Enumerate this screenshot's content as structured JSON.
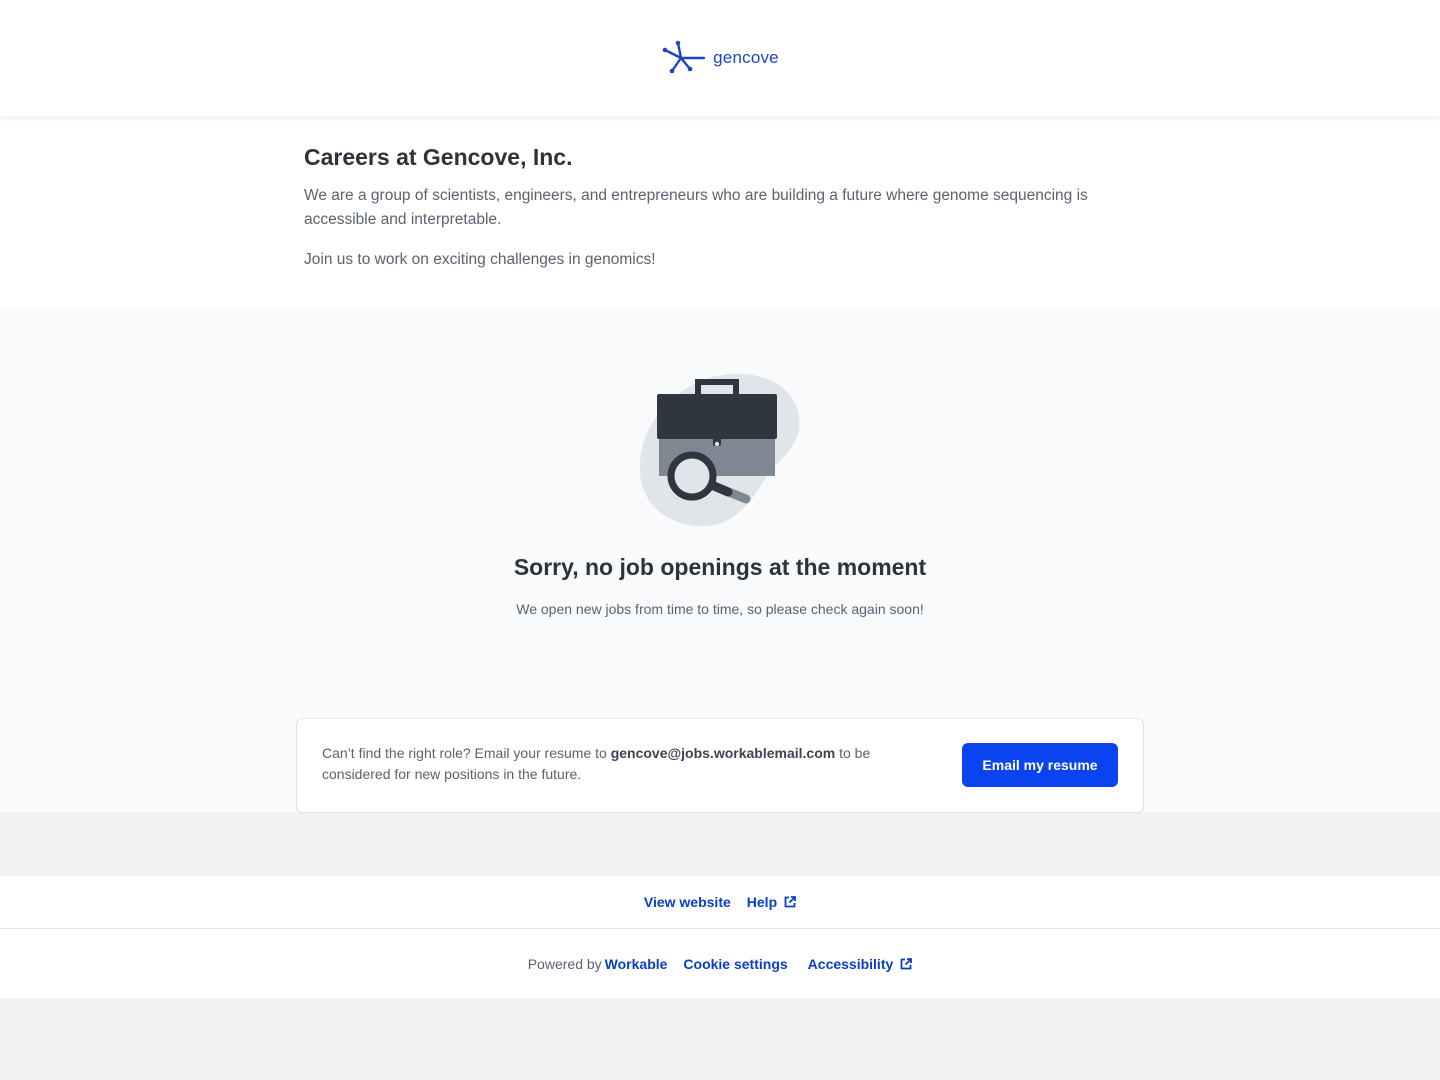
{
  "header": {
    "logo_text": "gencove",
    "brand_color": "#1c46c0"
  },
  "intro": {
    "title": "Careers at Gencove, Inc.",
    "description": "We are a group of scientists, engineers, and entrepreneurs who are building a future where genome sequencing is accessible and interpretable.",
    "join_text": "Join us to work on exciting challenges in genomics!"
  },
  "empty_state": {
    "illustration": "briefcase-search-icon",
    "heading": "Sorry, no job openings at the moment",
    "subtext": "We open new jobs from time to time, so please check again soon!"
  },
  "resume": {
    "text_prefix": "Can’t find the right role? Email your resume to ",
    "email": "gencove@jobs.workablemail.com",
    "text_suffix": " to be considered for new positions in the future.",
    "button_label": "Email my resume",
    "button_color": "#0a44f0"
  },
  "footer": {
    "view_website": "View website",
    "help": "Help",
    "powered_by": "Powered by",
    "workable": "Workable",
    "cookie_settings": "Cookie settings",
    "accessibility": "Accessibility",
    "link_color": "#0a3fc4"
  }
}
